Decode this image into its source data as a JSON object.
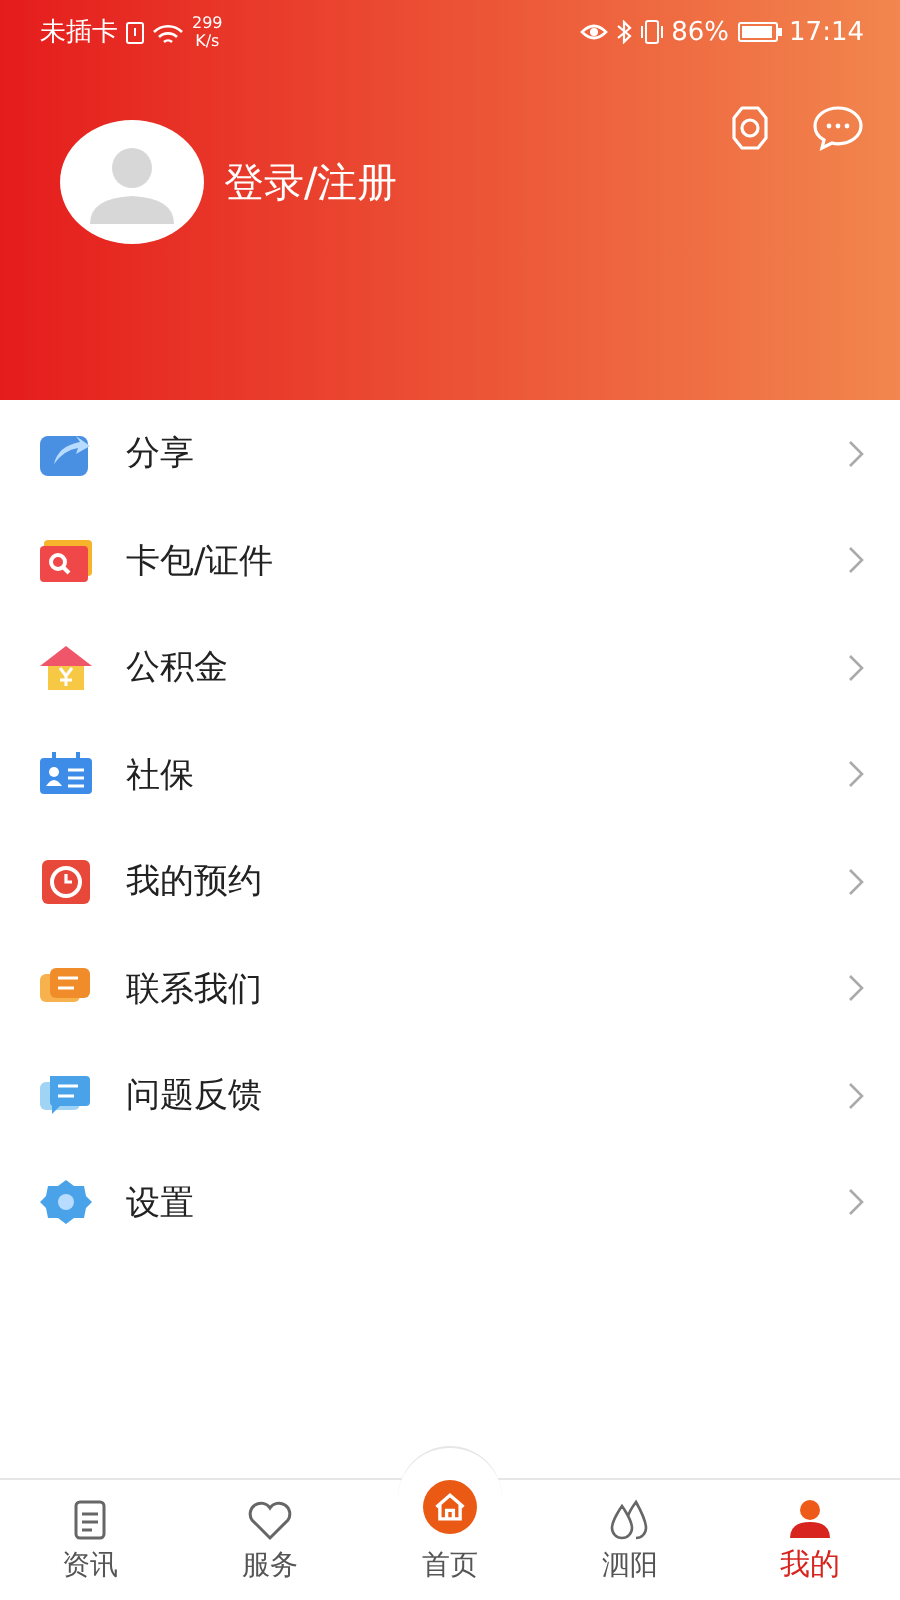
{
  "status_bar": {
    "carrier": "未插卡",
    "speed_value": "299",
    "speed_unit": "K/s",
    "battery": "86%",
    "time": "17:14"
  },
  "profile": {
    "login_label": "登录/注册"
  },
  "menu": [
    {
      "label": "分享"
    },
    {
      "label": "卡包/证件"
    },
    {
      "label": "公积金"
    },
    {
      "label": "社保"
    },
    {
      "label": "我的预约"
    },
    {
      "label": "联系我们"
    },
    {
      "label": "问题反馈"
    },
    {
      "label": "设置"
    }
  ],
  "bottom_nav": [
    {
      "label": "资讯",
      "kind": "normal",
      "selected": false
    },
    {
      "label": "服务",
      "kind": "normal",
      "selected": false
    },
    {
      "label": "首页",
      "kind": "center",
      "selected": false
    },
    {
      "label": "泗阳",
      "kind": "normal",
      "selected": false
    },
    {
      "label": "我的",
      "kind": "normal",
      "selected": true
    }
  ]
}
